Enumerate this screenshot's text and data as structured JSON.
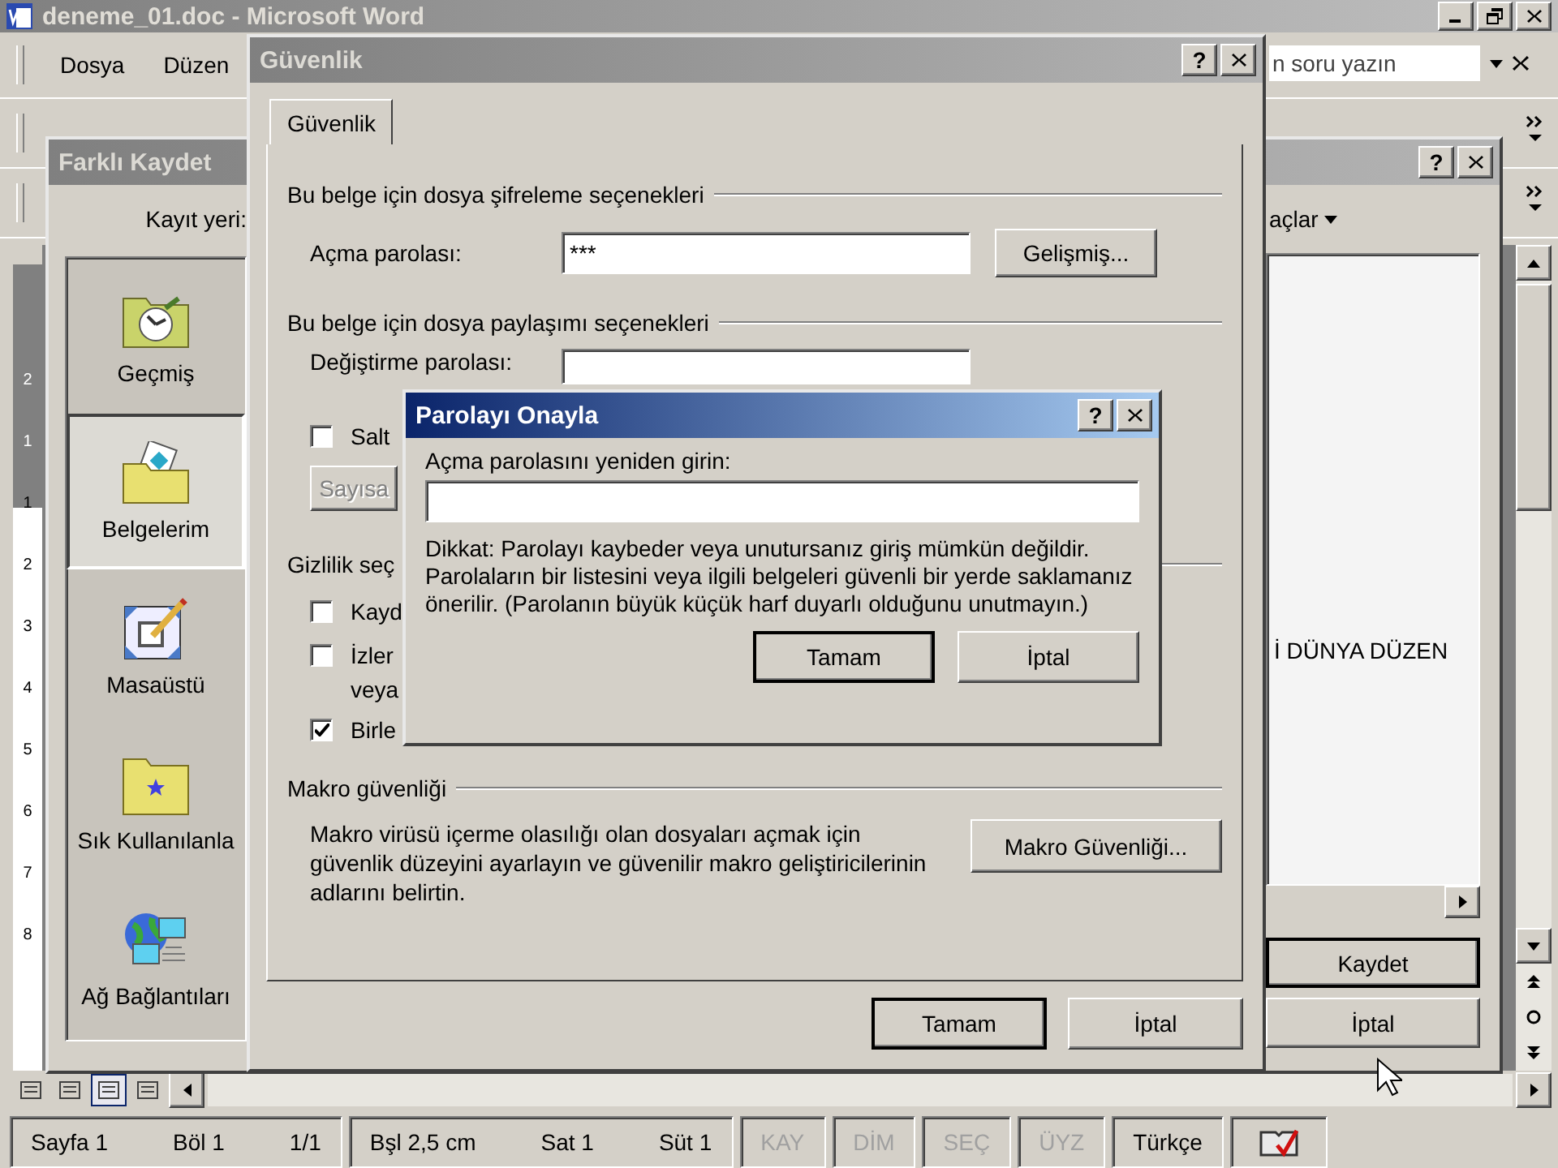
{
  "word_window": {
    "title": "deneme_01.doc - Microsoft Word",
    "menu": [
      {
        "label": "Dosya"
      },
      {
        "label": "Düzen"
      }
    ],
    "help_box": {
      "placeholder": "n soru yazın"
    },
    "ruler_numbers": [
      "2",
      "1",
      "1",
      "2",
      "3",
      "4",
      "5",
      "6",
      "7",
      "8"
    ],
    "view_buttons": [
      {
        "selected": false
      },
      {
        "selected": false
      },
      {
        "selected": true
      },
      {
        "selected": false
      }
    ]
  },
  "save_dialog": {
    "title": "Farklı Kaydet",
    "help_button": "?",
    "save_in_label": "Kayıt yeri:",
    "places": [
      {
        "label": "Geçmiş",
        "kind": "history",
        "selected": false
      },
      {
        "label": "Belgelerim",
        "kind": "documents",
        "selected": true
      },
      {
        "label": "Masaüstü",
        "kind": "desktop",
        "selected": false
      },
      {
        "label": "Sık Kullanılanla",
        "kind": "favorites",
        "selected": false
      },
      {
        "label": "Ağ Bağlantıları",
        "kind": "network",
        "selected": false
      }
    ],
    "tools_menu": "açlar",
    "file_list": [
      "İ DÜNYA DÜZEN"
    ],
    "buttons": [
      {
        "label": "Kaydet",
        "default": true
      },
      {
        "label": "İptal",
        "default": false
      }
    ]
  },
  "security_dialog": {
    "title": "Güvenlik",
    "help_button": "?",
    "tabs": [
      {
        "label": "Güvenlik",
        "selected": true
      }
    ],
    "encryption": {
      "heading": "Bu belge için dosya şifreleme seçenekleri",
      "label": "Açma parolası:",
      "value": "***",
      "button": "Gelişmiş..."
    },
    "sharing": {
      "heading": "Bu belge için dosya paylaşımı seçenekleri",
      "label": "Değiştirme parolası:",
      "read_only": {
        "label": "Salt",
        "checked": false
      },
      "button": {
        "label": "Sayısa",
        "disabled": true
      }
    },
    "privacy": {
      "heading": "Gizlilik seç",
      "options": [
        {
          "lines": [
            "Kayd"
          ],
          "checked": false
        },
        {
          "lines": [
            "İzler",
            "veya"
          ],
          "checked": false
        },
        {
          "lines": [
            "Birle"
          ],
          "checked": true
        }
      ]
    },
    "macro": {
      "heading": "Makro güvenliği",
      "text": "Makro virüsü içerme olasılığı olan dosyaları açmak için güvenlik düzeyini ayarlayın ve güvenilir makro geliştiricilerinin adlarını belirtin.",
      "button": "Makro Güvenliği..."
    },
    "buttons": [
      {
        "label": "Tamam",
        "default": true
      },
      {
        "label": "İptal",
        "default": false
      }
    ]
  },
  "confirm_dialog": {
    "title": "Parolayı Onayla",
    "help_button": "?",
    "label": "Açma parolasını yeniden girin:",
    "note": "Dikkat: Parolayı kaybeder veya unutursanız giriş mümkün değildir. Parolaların bir listesini veya ilgili belgeleri güvenli bir yerde saklamanız önerilir. (Parolanın büyük küçük harf duyarlı olduğunu unutmayın.)",
    "buttons": [
      {
        "label": "Tamam",
        "default": true
      },
      {
        "label": "İptal",
        "default": false
      }
    ]
  },
  "status_bar": {
    "sections": [
      {
        "items": [
          {
            "text": "Sayfa 1",
            "disabled": false
          },
          {
            "text": "Böl 1",
            "disabled": false
          },
          {
            "text": "1/1",
            "disabled": false
          }
        ]
      },
      {
        "items": [
          {
            "text": "Bşl 2,5 cm",
            "disabled": false
          },
          {
            "text": "Sat 1",
            "disabled": false
          },
          {
            "text": "Süt 1",
            "disabled": false
          }
        ]
      },
      {
        "items": [
          {
            "text": "KAY",
            "disabled": true
          }
        ]
      },
      {
        "items": [
          {
            "text": "DİM",
            "disabled": true
          }
        ]
      },
      {
        "items": [
          {
            "text": "SEÇ",
            "disabled": true
          }
        ]
      },
      {
        "items": [
          {
            "text": "ÜYZ",
            "disabled": true
          }
        ]
      },
      {
        "items": [
          {
            "text": "Türkçe",
            "disabled": false
          }
        ]
      }
    ]
  }
}
